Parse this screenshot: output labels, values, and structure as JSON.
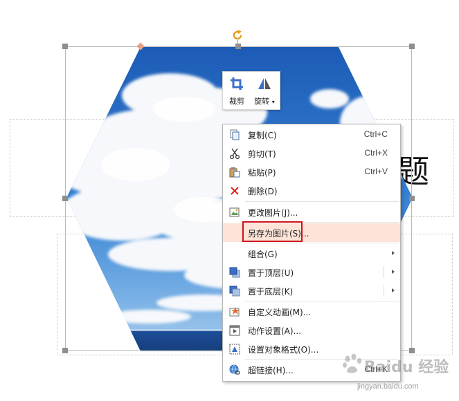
{
  "slide": {
    "title_glyph": "题"
  },
  "mini_toolbar": {
    "crop_label": "裁剪",
    "rotate_label": "旋转",
    "rotate_arrow": "▾"
  },
  "context_menu": {
    "items": [
      {
        "label": "复制(C)",
        "shortcut": "Ctrl+C",
        "icon": "copy-icon"
      },
      {
        "label": "剪切(T)",
        "shortcut": "Ctrl+X",
        "icon": "scissors-icon"
      },
      {
        "label": "粘贴(P)",
        "shortcut": "Ctrl+V",
        "icon": "paste-icon"
      },
      {
        "label": "删除(D)",
        "shortcut": "",
        "icon": "delete-x-icon"
      },
      {
        "label": "更改图片(J)...",
        "shortcut": "",
        "icon": "change-picture-icon"
      },
      {
        "label": "另存为图片(S)...",
        "shortcut": "",
        "icon": "",
        "highlighted": true
      },
      {
        "label": "组合(G)",
        "shortcut": "",
        "icon": "",
        "submenu": true
      },
      {
        "label": "置于顶层(U)",
        "shortcut": "",
        "icon": "bring-to-front-icon",
        "submenu": true
      },
      {
        "label": "置于底层(K)",
        "shortcut": "",
        "icon": "send-to-back-icon",
        "submenu": true
      },
      {
        "label": "自定义动画(M)...",
        "shortcut": "",
        "icon": "custom-animation-icon"
      },
      {
        "label": "动作设置(A)...",
        "shortcut": "",
        "icon": "action-settings-icon"
      },
      {
        "label": "设置对象格式(O)...",
        "shortcut": "",
        "icon": "format-object-icon"
      },
      {
        "label": "超链接(H)...",
        "shortcut": "Ctrl+K",
        "icon": "hyperlink-icon"
      }
    ]
  },
  "watermark": {
    "brand": "Baidu 经验",
    "url": "jingyan.baidu.com"
  },
  "colors": {
    "menu_highlight": "#fde3d8",
    "red_box": "#d0121b",
    "sky_blue": "#2b6fc4"
  }
}
